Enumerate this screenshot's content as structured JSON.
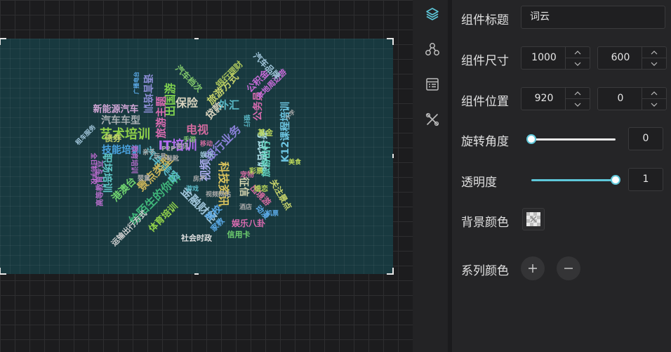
{
  "panel": {
    "title_label": "组件标题",
    "title_value": "词云",
    "size_label": "组件尺寸",
    "width_value": "1000",
    "height_value": "600",
    "position_label": "组件位置",
    "pos_x_value": "920",
    "pos_y_value": "0",
    "rotation_label": "旋转角度",
    "rotation_value": "0",
    "rotation_fraction": 0,
    "opacity_label": "透明度",
    "opacity_value": "1",
    "opacity_fraction": 1,
    "bg_color_label": "背景颜色",
    "series_color_label": "系列颜色"
  },
  "colors": {
    "accent": "#5ec7d9",
    "chart_bg": "#18393f",
    "panel_bg": "#252527"
  },
  "icons": [
    "layers-icon",
    "nodes-icon",
    "list-icon",
    "tools-icon"
  ],
  "wordcloud": [
    {
      "t": "IT培训",
      "c": "#b46cf0"
    },
    {
      "t": "科技资讯",
      "c": "#d8c25c"
    },
    {
      "t": "艺术培训",
      "c": "#8fd04a"
    },
    {
      "t": "金融财经",
      "c": "#9ec3d8"
    },
    {
      "t": "给陌生的你听",
      "c": "#3fb57a"
    },
    {
      "t": "保险",
      "c": "#d8d2bd"
    },
    {
      "t": "电视",
      "c": "#d06a9e"
    },
    {
      "t": "汽车美容",
      "c": "#5ab9c7"
    },
    {
      "t": "景点类型",
      "c": "#c9b45a"
    },
    {
      "t": "视频",
      "c": "#a7a9e8"
    },
    {
      "t": "出国游",
      "c": "#7fd14f"
    },
    {
      "t": "贷款",
      "c": "#d8d2bd"
    },
    {
      "t": "银行业务",
      "c": "#8a80d9"
    },
    {
      "t": "外汇",
      "c": "#5ab9c7"
    },
    {
      "t": "旅游主题",
      "c": "#d96bb0"
    },
    {
      "t": "驾校",
      "c": "#5aa9e6"
    },
    {
      "t": "港澳台",
      "c": "#6fd16f"
    },
    {
      "t": "汽车车型",
      "c": "#aab0b3"
    },
    {
      "t": "技能培训",
      "c": "#4aa3e0"
    },
    {
      "t": "职场培训",
      "c": "#5fc8c8"
    },
    {
      "t": "公务员",
      "c": "#d96bb0"
    },
    {
      "t": "考试培训",
      "c": "#a9dce5"
    },
    {
      "t": "旅游出行",
      "c": "#64d7c2"
    },
    {
      "t": "K12课程培训",
      "c": "#6cc4e0"
    },
    {
      "t": "新能源汽车",
      "c": "#d1a6d6"
    },
    {
      "t": "旅游方式",
      "c": "#c6d36a"
    },
    {
      "t": "体育培训",
      "c": "#8fd04a"
    },
    {
      "t": "征信",
      "c": "#d6d6b0"
    },
    {
      "t": "语言培训",
      "c": "#8f8fd9"
    },
    {
      "t": "公积金",
      "c": "#c46bd6"
    },
    {
      "t": "汽车档次",
      "c": "#7fc56a"
    },
    {
      "t": "银行理财",
      "c": "#a6c15a"
    },
    {
      "t": "债券",
      "c": "#c6d36a"
    },
    {
      "t": "本地周边游",
      "c": "#c46bd6"
    },
    {
      "t": "汽车品牌",
      "c": "#9ec3d8"
    },
    {
      "t": "高等教育专业",
      "c": "#b06bc6"
    },
    {
      "t": "娱乐八卦",
      "c": "#d96bb0"
    },
    {
      "t": "关注景点",
      "c": "#c6d36a"
    },
    {
      "t": "社会时政",
      "c": "#e0e0e0"
    },
    {
      "t": "信用卡",
      "c": "#6fd16f"
    },
    {
      "t": "家教",
      "c": "#5aa9e6"
    },
    {
      "t": "运输出行方式",
      "c": "#cfcfcf"
    },
    {
      "t": "出境游",
      "c": "#d06a9e"
    },
    {
      "t": "动漫",
      "c": "#5aa9e6"
    },
    {
      "t": "基金",
      "c": "#b8d45a"
    },
    {
      "t": "租车服务",
      "c": "#9ec3d8"
    },
    {
      "t": "全日制学校",
      "c": "#c46bd6"
    },
    {
      "t": "广播电台",
      "c": "#5aa9e6"
    },
    {
      "t": "教育培训",
      "c": "#b06bc6"
    },
    {
      "t": "小学",
      "c": "#a9a9a9"
    },
    {
      "t": "银行",
      "c": "#5ab9c7"
    },
    {
      "t": "婚恋",
      "c": "#b8d45a"
    },
    {
      "t": "娱乐",
      "c": "#9ec3d8"
    },
    {
      "t": "P2P",
      "c": "#a9a9a9"
    },
    {
      "t": "移动",
      "c": "#d06a9e"
    },
    {
      "t": "亲子",
      "c": "#a9a9a9"
    },
    {
      "t": "手游",
      "c": "#7fc56a"
    },
    {
      "t": "资讯",
      "c": "#a9a9a9"
    },
    {
      "t": "鞋靴",
      "c": "#a9a9a9"
    },
    {
      "t": "玩具",
      "c": "#a9a9a9"
    },
    {
      "t": "宠物",
      "c": "#d06a9e"
    },
    {
      "t": "彩票",
      "c": "#b8d45a"
    },
    {
      "t": "房产",
      "c": "#a9a9a9"
    },
    {
      "t": "游戏",
      "c": "#5ab9c7"
    },
    {
      "t": "视频网站",
      "c": "#a9a9a9"
    },
    {
      "t": "婴童",
      "c": "#a9a9a9"
    },
    {
      "t": "机票",
      "c": "#5aa9e6"
    },
    {
      "t": "酒店",
      "c": "#a9a9a9"
    },
    {
      "t": "美食",
      "c": "#b8d45a"
    }
  ]
}
